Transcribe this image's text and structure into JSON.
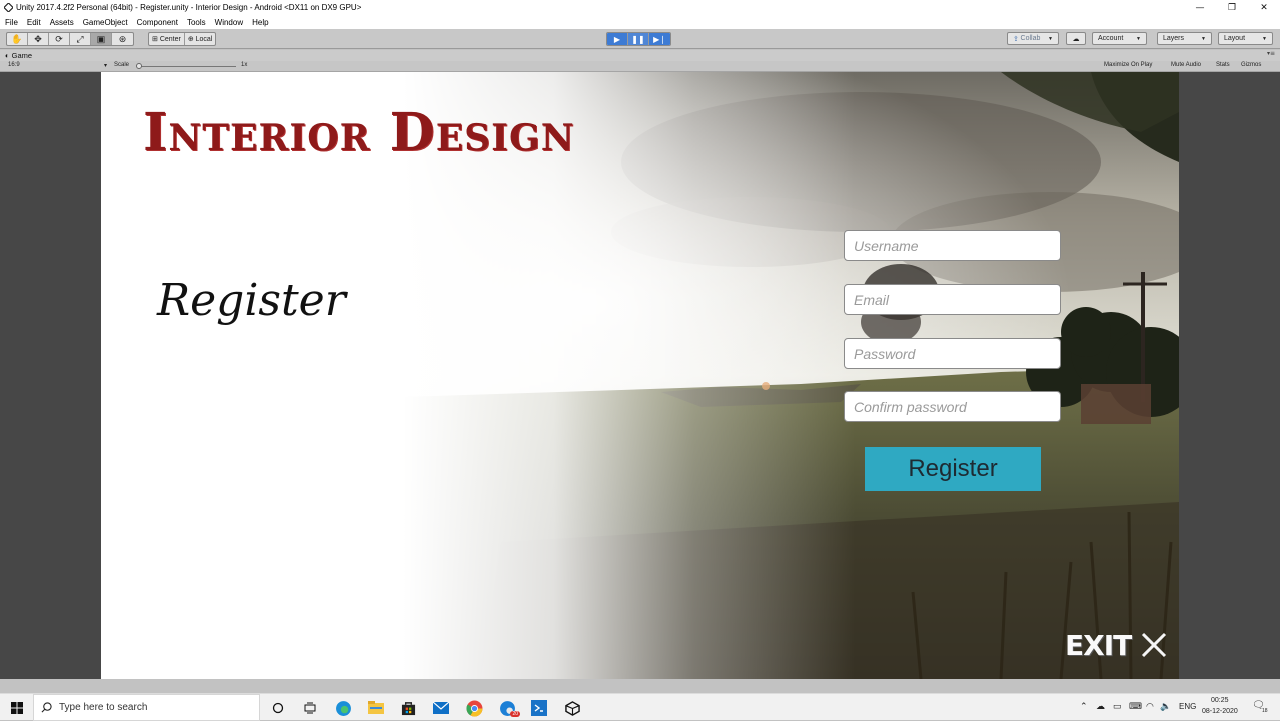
{
  "window": {
    "title": "Unity 2017.4.2f2 Personal (64bit) - Register.unity - Interior Design - Android <DX11 on DX9 GPU>",
    "controls": [
      "—",
      "❐",
      "✕"
    ]
  },
  "menu": [
    "File",
    "Edit",
    "Assets",
    "GameObject",
    "Component",
    "Tools",
    "Window",
    "Help"
  ],
  "toolbar": {
    "pivot_label": "Center",
    "space_label": "Local",
    "collab_label": "Collab",
    "account_label": "Account",
    "layers_label": "Layers",
    "layout_label": "Layout"
  },
  "game_view": {
    "tab_label": "Game",
    "aspect": "16:9",
    "scale_label": "Scale",
    "scale_value": "1x",
    "options": [
      "Maximize On Play",
      "Mute Audio",
      "Stats",
      "Gizmos"
    ]
  },
  "game": {
    "title": "Interior Design",
    "heading": "Register",
    "fields": {
      "username": "Username",
      "email": "Email",
      "password": "Password",
      "confirm_password": "Confirm password"
    },
    "register_button": "Register",
    "exit_label": "EXIT"
  },
  "taskbar": {
    "search_placeholder": "Type here to search",
    "language": "ENG",
    "time": "00:25",
    "date": "08-12-2020",
    "notification_count": "18",
    "chrome_badge": "20"
  },
  "colors": {
    "title_red": "#8e1a1a",
    "register_button": "#2fa9c2",
    "play_blue": "#3d7bd4"
  },
  "icons": {
    "tools": [
      "hand-icon",
      "move-icon",
      "rotate-icon",
      "scale-icon",
      "rect-icon",
      "transform-icon"
    ],
    "taskbar": [
      "cortana-icon",
      "task-view-icon",
      "edge-icon",
      "file-explorer-icon",
      "store-icon",
      "mail-icon",
      "chrome-icon",
      "edge-beta-icon",
      "vs-code-icon",
      "unity-icon"
    ]
  }
}
